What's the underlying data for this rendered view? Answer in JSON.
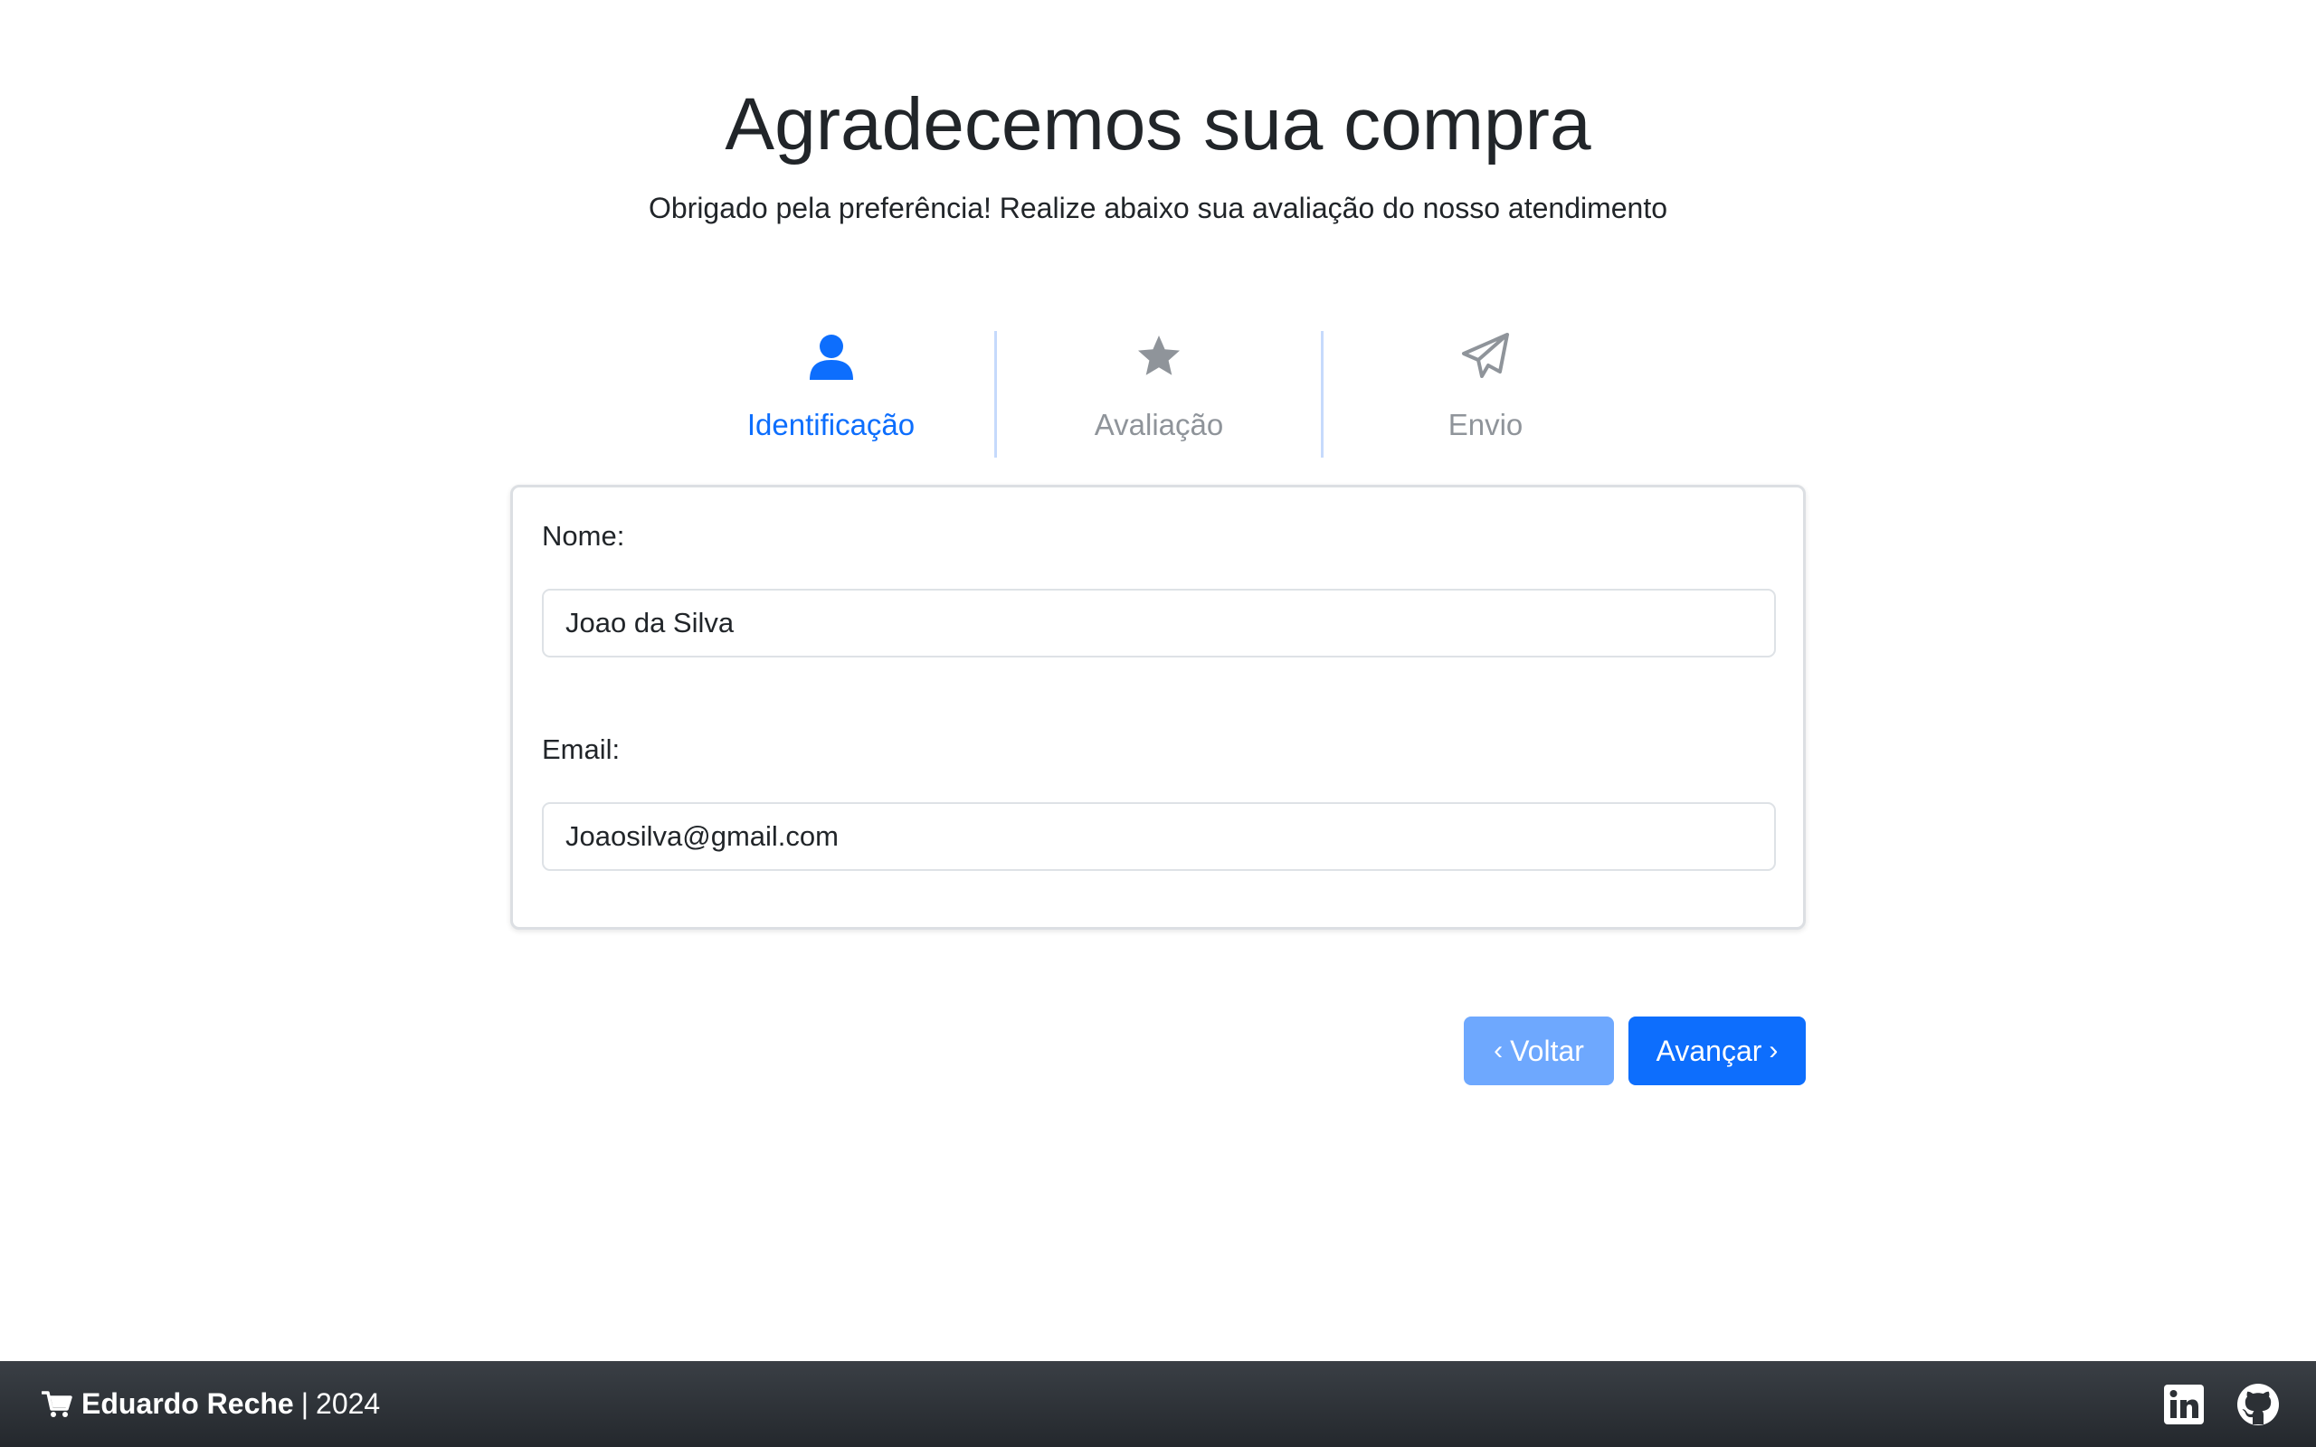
{
  "header": {
    "title": "Agradecemos sua compra",
    "subtitle": "Obrigado pela preferência! Realize abaixo sua avaliação do nosso atendimento"
  },
  "steps": [
    {
      "label": "Identificação",
      "icon": "user-icon",
      "active": true
    },
    {
      "label": "Avaliação",
      "icon": "star-icon",
      "active": false
    },
    {
      "label": "Envio",
      "icon": "paper-plane-icon",
      "active": false
    }
  ],
  "form": {
    "name_label": "Nome:",
    "name_value": "Joao da Silva",
    "email_label": "Email:",
    "email_value": "Joaosilva@gmail.com"
  },
  "buttons": {
    "back_label": "Voltar",
    "next_label": "Avançar"
  },
  "footer": {
    "author": "Eduardo Reche",
    "separator": "|",
    "year": "2024",
    "icons": [
      "cart-icon",
      "linkedin-icon",
      "github-icon"
    ]
  },
  "colors": {
    "primary": "#0d6efd",
    "primary_light": "#6ea8fe",
    "inactive": "#8f949a",
    "footer_bg": "#2c3035"
  }
}
